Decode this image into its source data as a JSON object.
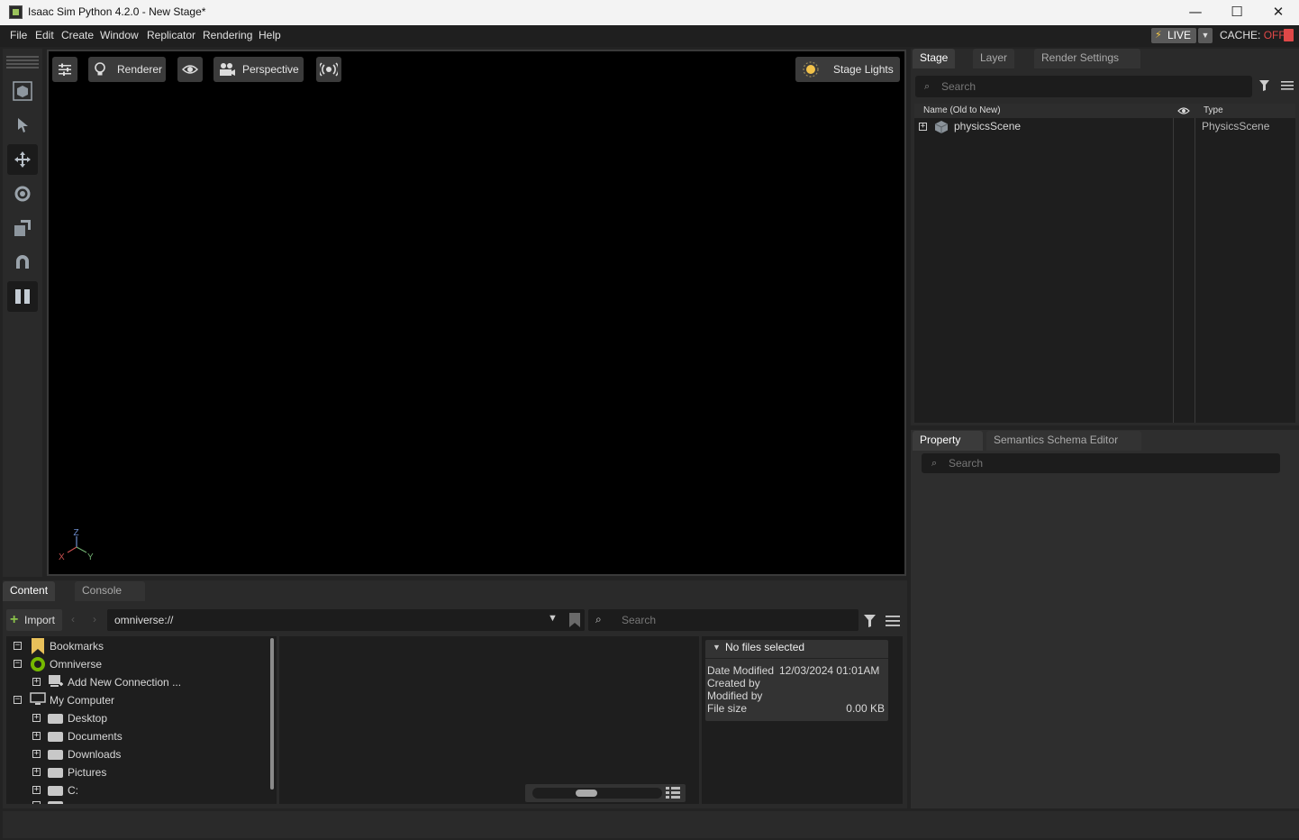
{
  "window": {
    "title": "Isaac Sim Python 4.2.0 - New Stage*",
    "controls": [
      "—",
      "☐",
      "✕"
    ]
  },
  "menu": {
    "items": [
      "File",
      "Edit",
      "Create",
      "Window",
      "Replicator",
      "Rendering",
      "Help"
    ],
    "live_label": "LIVE",
    "cache_label": "CACHE:",
    "cache_state": "OFF"
  },
  "viewport": {
    "renderer_label": "Renderer",
    "camera_label": "Perspective",
    "lights_label": "Stage Lights",
    "axis_labels": {
      "z": "Z",
      "x": "X",
      "y": "Y"
    }
  },
  "stage": {
    "tabs": [
      "Stage",
      "Layer",
      "Render Settings"
    ],
    "search_placeholder": "Search",
    "columns": {
      "name": "Name (Old to New)",
      "type": "Type"
    },
    "rows": [
      {
        "name": "physicsScene",
        "type": "PhysicsScene"
      }
    ]
  },
  "property": {
    "tabs": [
      "Property",
      "Semantics Schema Editor"
    ],
    "search_placeholder": "Search"
  },
  "content": {
    "tabs": [
      "Content",
      "Console"
    ],
    "import_label": "Import",
    "path": "omniverse://",
    "search_placeholder": "Search",
    "tree": [
      {
        "label": "Bookmarks",
        "level": 0
      },
      {
        "label": "Omniverse",
        "level": 0
      },
      {
        "label": "Add New Connection ...",
        "level": 1
      },
      {
        "label": "My Computer",
        "level": 0
      },
      {
        "label": "Desktop",
        "level": 1
      },
      {
        "label": "Documents",
        "level": 1
      },
      {
        "label": "Downloads",
        "level": 1
      },
      {
        "label": "Pictures",
        "level": 1
      },
      {
        "label": "C:",
        "level": 1
      }
    ],
    "details": {
      "header": "No files selected",
      "date_modified_label": "Date Modified",
      "date_modified_value": "12/03/2024 01:01AM",
      "created_by_label": "Created by",
      "modified_by_label": "Modified by",
      "file_size_label": "File size",
      "file_size_value": "0.00 KB"
    }
  }
}
